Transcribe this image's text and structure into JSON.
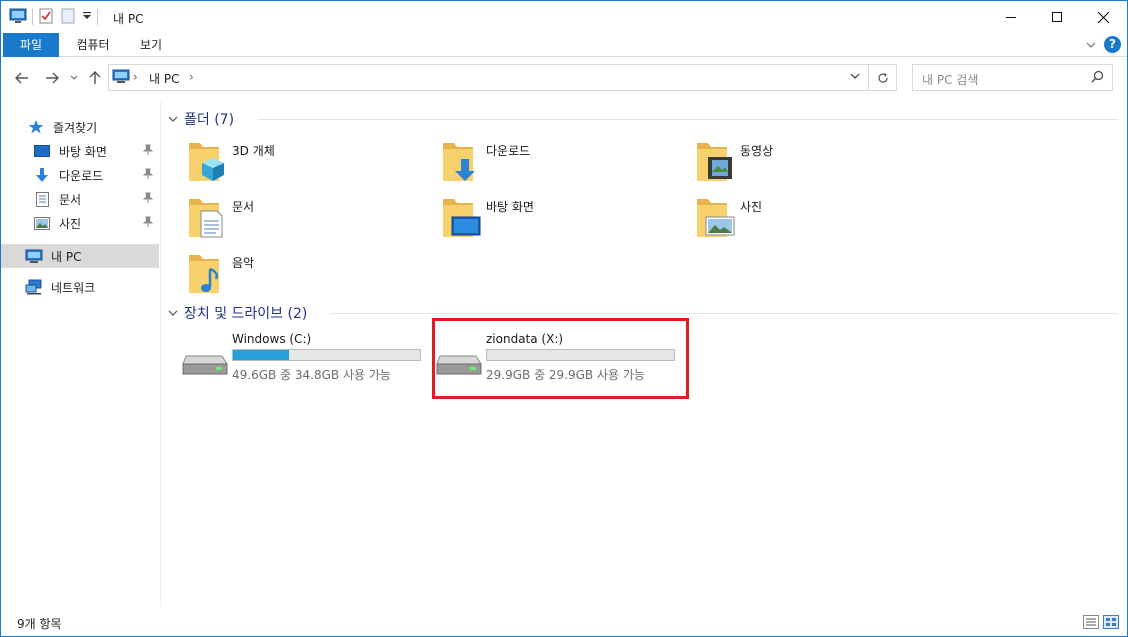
{
  "window": {
    "title": "내 PC"
  },
  "ribbon": {
    "tabs": [
      "파일",
      "컴퓨터",
      "보기"
    ]
  },
  "address": {
    "path": "내 PC",
    "separator": "›"
  },
  "search": {
    "placeholder": "내 PC 검색"
  },
  "nav": {
    "items": [
      {
        "label": "즐겨찾기",
        "icon": "star-icon"
      },
      {
        "label": "바탕 화면",
        "icon": "desktop-icon",
        "pinned": true
      },
      {
        "label": "다운로드",
        "icon": "download-icon",
        "pinned": true
      },
      {
        "label": "문서",
        "icon": "document-icon",
        "pinned": true
      },
      {
        "label": "사진",
        "icon": "pictures-icon",
        "pinned": true
      },
      {
        "label": "내 PC",
        "icon": "computer-icon",
        "selected": true
      },
      {
        "label": "네트워크",
        "icon": "network-icon"
      }
    ]
  },
  "groups": {
    "folders": {
      "title": "폴더 (7)"
    },
    "drives": {
      "title": "장치 및 드라이브 (2)"
    }
  },
  "folders": [
    {
      "label": "3D 개체",
      "icon": "3d-objects-folder-icon"
    },
    {
      "label": "다운로드",
      "icon": "downloads-folder-icon"
    },
    {
      "label": "동영상",
      "icon": "videos-folder-icon"
    },
    {
      "label": "문서",
      "icon": "documents-folder-icon"
    },
    {
      "label": "바탕 화면",
      "icon": "desktop-folder-icon"
    },
    {
      "label": "사진",
      "icon": "pictures-folder-icon"
    },
    {
      "label": "음악",
      "icon": "music-folder-icon"
    }
  ],
  "drives": [
    {
      "name": "Windows (C:)",
      "free_text": "49.6GB 중 34.8GB 사용 가능",
      "used_fraction": 0.3
    },
    {
      "name": "ziondata (X:)",
      "free_text": "29.9GB 중 29.9GB 사용 가능",
      "used_fraction": 0.0
    }
  ],
  "status": {
    "count": "9개 항목"
  },
  "colors": {
    "accent": "#1979ca",
    "highlight": "#e01b24",
    "bar_fill": "#26a0da",
    "group_header": "#1e3287"
  }
}
